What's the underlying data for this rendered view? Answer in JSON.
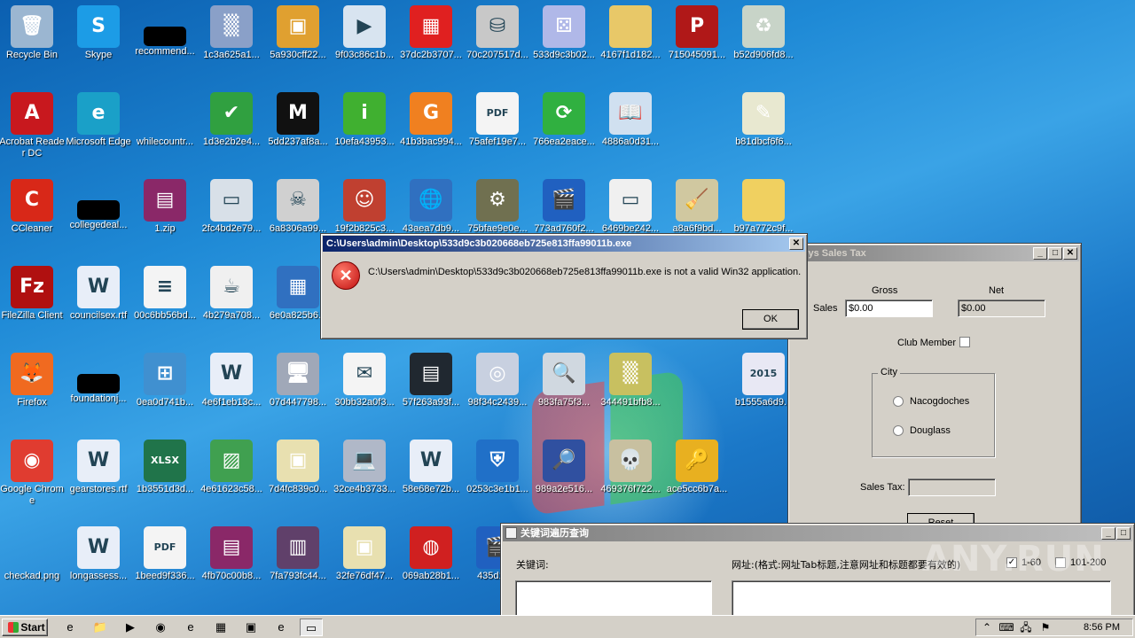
{
  "desktop": {
    "icons": [
      {
        "label": "Recycle Bin",
        "icon": "recycle-bin-icon",
        "glyph": "🗑",
        "bg": "#9bb6d1",
        "col": 0,
        "row": 0,
        "shortcut": false
      },
      {
        "label": "Skype",
        "icon": "skype-icon",
        "glyph": "S",
        "bg": "#1c9ce6",
        "col": 1,
        "row": 0,
        "shortcut": true
      },
      {
        "label": "recommend...",
        "icon": "black-file-icon",
        "glyph": "",
        "bg": "#000000",
        "col": 2,
        "row": 0,
        "shortcut": false
      },
      {
        "label": "1c3a625a1...",
        "icon": "noise-image-icon",
        "glyph": "▒",
        "bg": "#8aa0c8",
        "col": 3,
        "row": 0,
        "shortcut": false
      },
      {
        "label": "5a930cff22...",
        "icon": "package-icon",
        "glyph": "▣",
        "bg": "#e0a030",
        "col": 4,
        "row": 0,
        "shortcut": false
      },
      {
        "label": "9f03c86c1b...",
        "icon": "media-player-icon",
        "glyph": "▶",
        "bg": "#d8e4f0",
        "col": 5,
        "row": 0,
        "shortcut": false
      },
      {
        "label": "37dc2b3707...",
        "icon": "color-squares-icon",
        "glyph": "▦",
        "bg": "#e02020",
        "col": 6,
        "row": 0,
        "shortcut": false
      },
      {
        "label": "70c207517d...",
        "icon": "usb-drive-icon",
        "glyph": "⛁",
        "bg": "#c8c8c8",
        "col": 7,
        "row": 0,
        "shortcut": false
      },
      {
        "label": "533d9c3b02...",
        "icon": "dice-icon",
        "glyph": "⚄",
        "bg": "#b0b8e8",
        "col": 8,
        "row": 0,
        "shortcut": false
      },
      {
        "label": "4167f1d182...",
        "icon": "folder-icon",
        "glyph": "",
        "bg": "#e8c868",
        "col": 9,
        "row": 0,
        "shortcut": false
      },
      {
        "label": "715045091...",
        "icon": "app-red-icon",
        "glyph": "P",
        "bg": "#b01818",
        "col": 10,
        "row": 0,
        "shortcut": false
      },
      {
        "label": "b52d906fd8...",
        "icon": "recycle-full-icon",
        "glyph": "♻",
        "bg": "#c8d4c8",
        "col": 11,
        "row": 0,
        "shortcut": false
      },
      {
        "label": "Acrobat Reader DC",
        "icon": "acrobat-icon",
        "glyph": "A",
        "bg": "#c8181e",
        "col": 0,
        "row": 1,
        "shortcut": true
      },
      {
        "label": "Microsoft Edge",
        "icon": "edge-icon",
        "glyph": "e",
        "bg": "#1aa0c8",
        "col": 1,
        "row": 1,
        "shortcut": true
      },
      {
        "label": "whilecountr...",
        "icon": "blank-file-icon",
        "glyph": "",
        "bg": "transparent",
        "col": 2,
        "row": 1,
        "shortcut": false
      },
      {
        "label": "1d3e2b2e4...",
        "icon": "shield-check-icon",
        "glyph": "✔",
        "bg": "#30a040",
        "col": 3,
        "row": 1,
        "shortcut": false
      },
      {
        "label": "5dd237af8a...",
        "icon": "letter-m-icon",
        "glyph": "M",
        "bg": "#111111",
        "col": 4,
        "row": 1,
        "shortcut": false
      },
      {
        "label": "10efa43953...",
        "icon": "info-icon",
        "glyph": "i",
        "bg": "#40b030",
        "col": 5,
        "row": 1,
        "shortcut": false
      },
      {
        "label": "41b3bac994...",
        "icon": "orange-box-icon",
        "glyph": "G",
        "bg": "#f08020",
        "col": 6,
        "row": 1,
        "shortcut": false
      },
      {
        "label": "75afef19e7...",
        "icon": "pdf-icon",
        "glyph": "PDF",
        "bg": "#f4f4f4",
        "col": 7,
        "row": 1,
        "shortcut": false
      },
      {
        "label": "766ea2eace...",
        "icon": "sync-arrows-icon",
        "glyph": "⟳",
        "bg": "#30b040",
        "col": 8,
        "row": 1,
        "shortcut": false
      },
      {
        "label": "4886a0d31...",
        "icon": "open-book-icon",
        "glyph": "📖",
        "bg": "#d0e0f0",
        "col": 9,
        "row": 1,
        "shortcut": false
      },
      {
        "label": "b81dbcf6f6...",
        "icon": "picture-edit-icon",
        "glyph": "✎",
        "bg": "#e8e8d0",
        "col": 11,
        "row": 1,
        "shortcut": false
      },
      {
        "label": "CCleaner",
        "icon": "ccleaner-icon",
        "glyph": "C",
        "bg": "#d82818",
        "col": 0,
        "row": 2,
        "shortcut": true
      },
      {
        "label": "collegedeal...",
        "icon": "black-file-icon",
        "glyph": "",
        "bg": "#000000",
        "col": 1,
        "row": 2,
        "shortcut": false
      },
      {
        "label": "1.zip",
        "icon": "winrar-icon",
        "glyph": "▤",
        "bg": "#8a2868",
        "col": 2,
        "row": 2,
        "shortcut": false
      },
      {
        "label": "2fc4bd2e79...",
        "icon": "window-app-icon",
        "glyph": "▭",
        "bg": "#d8e0e8",
        "col": 3,
        "row": 2,
        "shortcut": false
      },
      {
        "label": "6a8306a99...",
        "icon": "skull-crossbones-icon",
        "glyph": "☠",
        "bg": "#d0d0d0",
        "col": 4,
        "row": 2,
        "shortcut": false
      },
      {
        "label": "19f2b825c3...",
        "icon": "anime-face-icon",
        "glyph": "☺",
        "bg": "#c04030",
        "col": 5,
        "row": 2,
        "shortcut": false
      },
      {
        "label": "43aea7db9...",
        "icon": "globe-network-icon",
        "glyph": "🌐",
        "bg": "#3070c0",
        "col": 6,
        "row": 2,
        "shortcut": false
      },
      {
        "label": "75bfae9e0e...",
        "icon": "installer-icon",
        "glyph": "⚙",
        "bg": "#707050",
        "col": 7,
        "row": 2,
        "shortcut": false
      },
      {
        "label": "773ad760f2...",
        "icon": "clapperboard-icon",
        "glyph": "🎬",
        "bg": "#2060c0",
        "col": 8,
        "row": 2,
        "shortcut": false
      },
      {
        "label": "6469be242...",
        "icon": "window-icon",
        "glyph": "▭",
        "bg": "#f0f0f0",
        "col": 9,
        "row": 2,
        "shortcut": false
      },
      {
        "label": "a8a6f9bd...",
        "icon": "broom-icon",
        "glyph": "🧹",
        "bg": "#d0c8a0",
        "col": 10,
        "row": 2,
        "shortcut": false
      },
      {
        "label": "b97a772c9f...",
        "icon": "folder-icon",
        "glyph": "",
        "bg": "#f0d060",
        "col": 11,
        "row": 2,
        "shortcut": false
      },
      {
        "label": "FileZilla Client",
        "icon": "filezilla-icon",
        "glyph": "Fz",
        "bg": "#b01010",
        "col": 0,
        "row": 3,
        "shortcut": true
      },
      {
        "label": "councilsex.rtf",
        "icon": "word-doc-icon",
        "glyph": "W",
        "bg": "#e8eef8",
        "col": 1,
        "row": 3,
        "shortcut": false
      },
      {
        "label": "00c6bb56bd...",
        "icon": "text-doc-icon",
        "glyph": "≡",
        "bg": "#f4f4f4",
        "col": 2,
        "row": 3,
        "shortcut": false
      },
      {
        "label": "4b279a708...",
        "icon": "java-icon",
        "glyph": "☕",
        "bg": "#f0f0f0",
        "col": 3,
        "row": 3,
        "shortcut": false
      },
      {
        "label": "6e0a825b6...",
        "icon": "calculator-icon",
        "glyph": "▦",
        "bg": "#3070c0",
        "col": 4,
        "row": 3,
        "shortcut": false
      },
      {
        "label": "Firefox",
        "icon": "firefox-icon",
        "glyph": "🦊",
        "bg": "#f06a20",
        "col": 0,
        "row": 4,
        "shortcut": true
      },
      {
        "label": "foundationj...",
        "icon": "black-file-icon",
        "glyph": "",
        "bg": "#000000",
        "col": 1,
        "row": 4,
        "shortcut": false
      },
      {
        "label": "0ea0d741b...",
        "icon": "windows-logo-icon",
        "glyph": "⊞",
        "bg": "#4090d0",
        "col": 2,
        "row": 4,
        "shortcut": false
      },
      {
        "label": "4e6f1eb13c...",
        "icon": "word-doc-icon",
        "glyph": "W",
        "bg": "#e8eef8",
        "col": 3,
        "row": 4,
        "shortcut": false
      },
      {
        "label": "07d447798...",
        "icon": "computer-tower-icon",
        "glyph": "🖥",
        "bg": "#a0a8b8",
        "col": 4,
        "row": 4,
        "shortcut": false
      },
      {
        "label": "30bb32a0f3...",
        "icon": "envelope-icon",
        "glyph": "✉",
        "bg": "#f4f4f4",
        "col": 5,
        "row": 4,
        "shortcut": false
      },
      {
        "label": "57f263a93f...",
        "icon": "id-card-icon",
        "glyph": "▤",
        "bg": "#202830",
        "col": 6,
        "row": 4,
        "shortcut": false
      },
      {
        "label": "98f34c2439...",
        "icon": "disc-installer-icon",
        "glyph": "◎",
        "bg": "#c8d0e0",
        "col": 7,
        "row": 4,
        "shortcut": false
      },
      {
        "label": "983fa75f3...",
        "icon": "magnifier-camera-icon",
        "glyph": "🔍",
        "bg": "#d0d8e0",
        "col": 8,
        "row": 4,
        "shortcut": false
      },
      {
        "label": "344491bfb8...",
        "icon": "noise-image-icon",
        "glyph": "▒",
        "bg": "#c8c060",
        "col": 9,
        "row": 4,
        "shortcut": false
      },
      {
        "label": "b1555a6d9...",
        "icon": "year-2015-icon",
        "glyph": "2015",
        "bg": "#e8e8f4",
        "col": 11,
        "row": 4,
        "shortcut": false
      },
      {
        "label": "Google Chrome",
        "icon": "chrome-icon",
        "glyph": "◉",
        "bg": "#e03c30",
        "col": 0,
        "row": 5,
        "shortcut": true
      },
      {
        "label": "gearstores.rtf",
        "icon": "word-doc-icon",
        "glyph": "W",
        "bg": "#e8eef8",
        "col": 1,
        "row": 5,
        "shortcut": false
      },
      {
        "label": "1b3551d3d...",
        "icon": "xlsx-icon",
        "glyph": "XLSX",
        "bg": "#20744a",
        "col": 2,
        "row": 5,
        "shortcut": false
      },
      {
        "label": "4e61623c58...",
        "icon": "green-image-icon",
        "glyph": "▨",
        "bg": "#40a050",
        "col": 3,
        "row": 5,
        "shortcut": false
      },
      {
        "label": "7d4fc839c0...",
        "icon": "installer-window-icon",
        "glyph": "▣",
        "bg": "#e8e0b0",
        "col": 4,
        "row": 5,
        "shortcut": false
      },
      {
        "label": "32ce4b3733...",
        "icon": "laptop-icon",
        "glyph": "💻",
        "bg": "#b0b8c8",
        "col": 5,
        "row": 5,
        "shortcut": false
      },
      {
        "label": "58e68e72b...",
        "icon": "word-doc-icon",
        "glyph": "W",
        "bg": "#e8eef8",
        "col": 6,
        "row": 5,
        "shortcut": false
      },
      {
        "label": "0253c3e1b1...",
        "icon": "shield-pulse-icon",
        "glyph": "⛨",
        "bg": "#2070c8",
        "col": 7,
        "row": 5,
        "shortcut": false
      },
      {
        "label": "989a2e516...",
        "icon": "magnifier-monitor-icon",
        "glyph": "🔎",
        "bg": "#3050a0",
        "col": 8,
        "row": 5,
        "shortcut": false
      },
      {
        "label": "469376f722...",
        "icon": "skull-icon",
        "glyph": "💀",
        "bg": "#c8c0a0",
        "col": 9,
        "row": 5,
        "shortcut": false
      },
      {
        "label": "ace5cc6b7a...",
        "icon": "key-icon",
        "glyph": "🔑",
        "bg": "#e8b020",
        "col": 10,
        "row": 5,
        "shortcut": false
      },
      {
        "label": "checkad.png",
        "icon": "blank-image-icon",
        "glyph": "",
        "bg": "transparent",
        "col": 0,
        "row": 6,
        "shortcut": false
      },
      {
        "label": "longassess...",
        "icon": "word-doc-icon",
        "glyph": "W",
        "bg": "#e8eef8",
        "col": 1,
        "row": 6,
        "shortcut": false
      },
      {
        "label": "1beed9f336...",
        "icon": "pdf-icon",
        "glyph": "PDF",
        "bg": "#f4f4f4",
        "col": 2,
        "row": 6,
        "shortcut": false
      },
      {
        "label": "4fb70c00b8...",
        "icon": "winrar-icon",
        "glyph": "▤",
        "bg": "#8a2868",
        "col": 3,
        "row": 6,
        "shortcut": false
      },
      {
        "label": "7fa793fc44...",
        "icon": "books-icon",
        "glyph": "▥",
        "bg": "#60406a",
        "col": 4,
        "row": 6,
        "shortcut": false
      },
      {
        "label": "32fe76df47...",
        "icon": "installer-window-icon",
        "glyph": "▣",
        "bg": "#e8e0b0",
        "col": 5,
        "row": 6,
        "shortcut": false
      },
      {
        "label": "069ab28b1...",
        "icon": "box-globe-icon",
        "glyph": "◍",
        "bg": "#d02020",
        "col": 6,
        "row": 6,
        "shortcut": false
      },
      {
        "label": "435d1a...",
        "icon": "clapperboard-icon",
        "glyph": "🎬",
        "bg": "#2060c0",
        "col": 7,
        "row": 6,
        "shortcut": false
      }
    ]
  },
  "error_dialog": {
    "title": "C:\\Users\\admin\\Desktop\\533d9c3b020668eb725e813ffa99011b.exe",
    "message": "C:\\Users\\admin\\Desktop\\533d9c3b020668eb725e813ffa99011b.exe is not a valid Win32 application.",
    "ok_label": "OK",
    "close_glyph": "✕",
    "icon": "error-icon",
    "icon_glyph": "✕"
  },
  "sales_tax_window": {
    "title": "nmys Sales Tax",
    "gross_label": "Gross",
    "net_label": "Net",
    "sales_label": "Sales",
    "gross_value": "$0.00",
    "net_value": "$0.00",
    "club_member_label": "Club Member",
    "city_label": "City",
    "city_options": [
      "Nacogdoches",
      "Douglass"
    ],
    "sales_tax_label": "Sales Tax:",
    "sales_tax_value": "",
    "reset_label": "Reset",
    "min_glyph": "_",
    "max_glyph": "□",
    "close_glyph": "✕"
  },
  "keyword_window": {
    "title": "关键词遍历查询",
    "keyword_label": "关键词:",
    "url_label": "网址:(格式:网址Tab标题,注意网址和标题都要有效的)",
    "range1_label": "1-60",
    "range2_label": "101-200",
    "range1_checked": "✓",
    "min_glyph": "_",
    "max_glyph": "□"
  },
  "taskbar": {
    "start_label": "Start",
    "clock": "8:56 PM",
    "items": [
      {
        "icon": "ie-icon",
        "glyph": "e"
      },
      {
        "icon": "explorer-icon",
        "glyph": "📁"
      },
      {
        "icon": "media-player-icon",
        "glyph": "▶"
      },
      {
        "icon": "chrome-icon",
        "glyph": "◉"
      },
      {
        "icon": "edge-icon",
        "glyph": "e"
      },
      {
        "icon": "color-squares-icon",
        "glyph": "▦"
      },
      {
        "icon": "installer-window-icon",
        "glyph": "▣"
      },
      {
        "icon": "ie-icon",
        "glyph": "e"
      },
      {
        "icon": "window-icon",
        "glyph": "▭"
      }
    ],
    "tray": [
      {
        "icon": "chevron-up-icon",
        "glyph": "⌃"
      },
      {
        "icon": "keyboard-icon",
        "glyph": "⌨"
      },
      {
        "icon": "network-icon",
        "glyph": "🖧"
      },
      {
        "icon": "flag-icon",
        "glyph": "⚑"
      }
    ]
  },
  "watermark": "ANY.RUN"
}
